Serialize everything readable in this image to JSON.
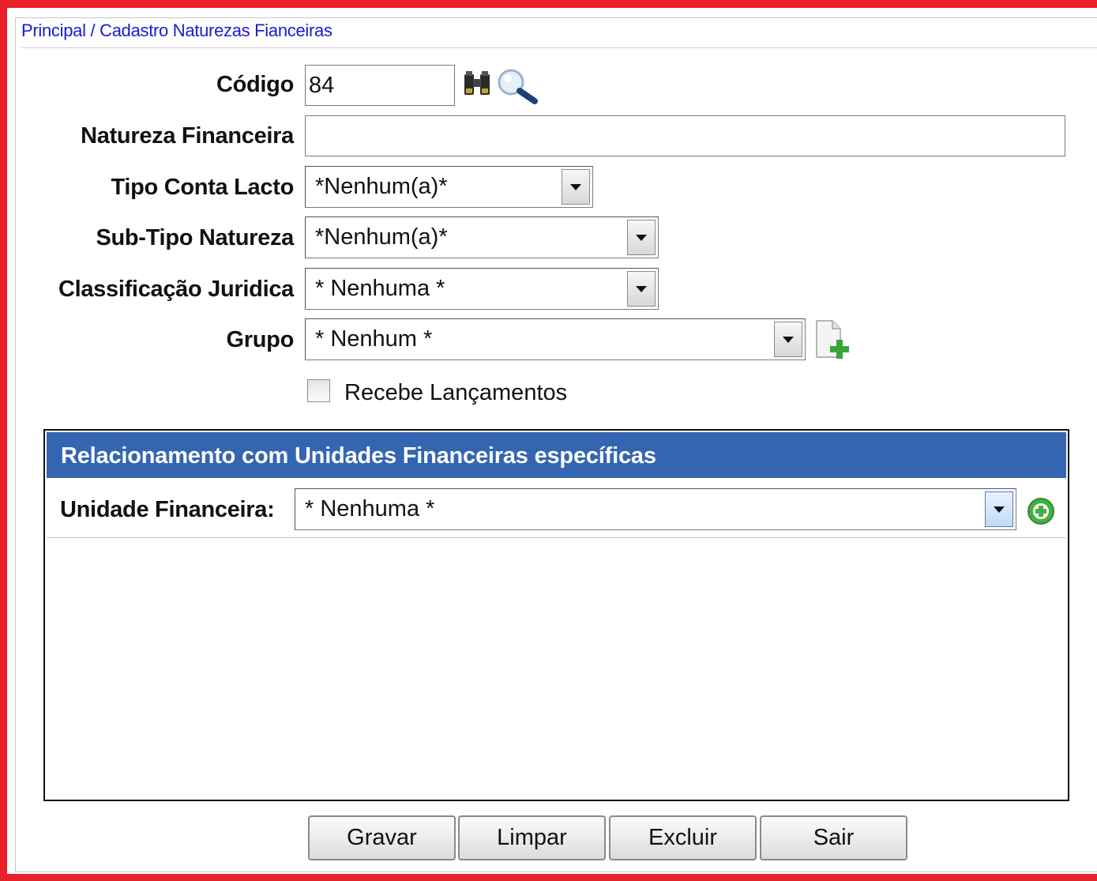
{
  "breadcrumb": "Principal / Cadastro Naturezas Fianceiras",
  "form": {
    "codigo": {
      "label": "Código",
      "value": "84"
    },
    "natureza": {
      "label": "Natureza Financeira",
      "value": ""
    },
    "tipo_conta": {
      "label": "Tipo Conta Lacto",
      "selected": "*Nenhum(a)*"
    },
    "sub_tipo": {
      "label": "Sub-Tipo Natureza",
      "selected": "*Nenhum(a)*"
    },
    "classificacao": {
      "label": "Classificação Juridica",
      "selected": "* Nenhuma *"
    },
    "grupo": {
      "label": "Grupo",
      "selected": "* Nenhum *"
    },
    "recebe": {
      "label": "Recebe Lançamentos",
      "checked": false
    }
  },
  "panel": {
    "title": "Relacionamento com Unidades Financeiras específicas",
    "unidade_label": "Unidade Financeira:",
    "unidade_selected": "* Nenhuma *"
  },
  "buttons": {
    "gravar": "Gravar",
    "limpar": "Limpar",
    "excluir": "Excluir",
    "sair": "Sair"
  },
  "icons": {
    "binoculars": "binoculars-icon",
    "search": "magnifier-icon",
    "new_group": "add-document-icon",
    "add_unit": "add-circle-icon"
  },
  "colors": {
    "frame": "#e8202a",
    "panel_header": "#3465b0",
    "link": "#1a1ad0",
    "add_green": "#3faa3f"
  }
}
